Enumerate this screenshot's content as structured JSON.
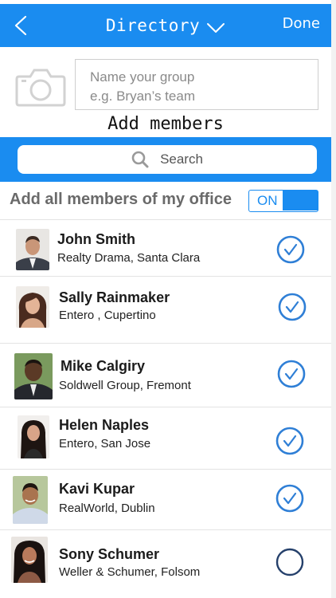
{
  "nav": {
    "back_icon": "chevron-left-icon",
    "title": "Directory",
    "title_dropdown_icon": "chevron-down-icon",
    "done_label": "Done",
    "bg_color": "#1a8cf0"
  },
  "group": {
    "camera_icon": "camera-icon",
    "name_placeholder_line1": "Name your group",
    "name_placeholder_line2": "e.g. Bryan’s team",
    "add_members_label": "Add members"
  },
  "search": {
    "icon": "search-icon",
    "placeholder": "Search"
  },
  "office": {
    "label": "Add all members of my office",
    "toggle_label": "ON",
    "toggle_state": true
  },
  "members": [
    {
      "name": "John Smith",
      "company": "Realty Drama, Santa Clara",
      "selected": true
    },
    {
      "name": "Sally Rainmaker",
      "company": "Entero , Cupertino",
      "selected": true
    },
    {
      "name": "Mike Calgiry",
      "company": "Soldwell Group, Fremont",
      "selected": true
    },
    {
      "name": "Helen Naples",
      "company": "Entero, San Jose",
      "selected": true
    },
    {
      "name": "Kavi Kupar",
      "company": "RealWorld, Dublin",
      "selected": true
    },
    {
      "name": "Sony Schumer",
      "company": "Weller & Schumer, Folsom",
      "selected": false
    }
  ],
  "colors": {
    "accent": "#1a8cf0",
    "check": "#2f7fd6"
  }
}
